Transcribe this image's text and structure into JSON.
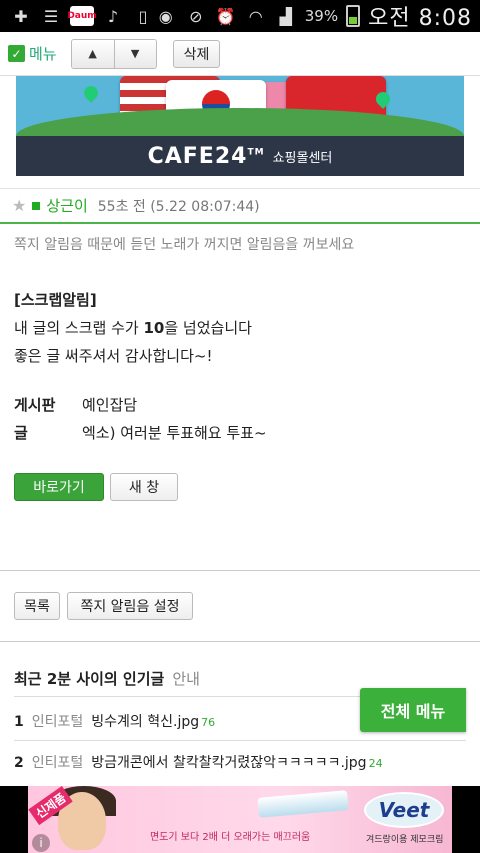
{
  "status_bar": {
    "battery_pct": "39%",
    "time": "오전 8:08",
    "icons": [
      "add-icon",
      "list-icon",
      "daum-app-icon",
      "music-icon",
      "download-done-icon",
      "eye-icon",
      "mute-icon",
      "alarm-icon",
      "wifi-icon",
      "signal-icon",
      "battery-icon"
    ],
    "daum_label": "Daum"
  },
  "toolbar": {
    "menu_label": "메뉴",
    "up_label": "▲",
    "down_label": "▼",
    "delete_label": "삭제"
  },
  "banner": {
    "logo": "CAFE24",
    "tm": "TM",
    "sub": "쇼핑몰센터"
  },
  "message": {
    "sender": "상근이",
    "meta": "55초 전 (5.22 08:07:44)",
    "notice": "쪽지 알림음 때문에 듣던 노래가 꺼지면 알림음을 꺼보세요",
    "heading": "[스크랩알림]",
    "line1_pre": "내 글의 스크랩 수가 ",
    "line1_bold": "10",
    "line1_post": "을 넘었습니다",
    "line2": "좋은 글 써주셔서 감사합니다~!",
    "board_key": "게시판",
    "board_val": "예인잡담",
    "post_key": "글",
    "post_val": "엑소) 여러분 투표해요 투표~",
    "go_label": "바로가기",
    "new_window_label": "새 창"
  },
  "actions": {
    "list_label": "목록",
    "settings_label": "쪽지 알림음 설정"
  },
  "popular": {
    "title": "최근 2분 사이의 인기글",
    "subtitle": "안내",
    "items": [
      {
        "rank": "1",
        "category": "인티포털",
        "title": "빙수계의 혁신.jpg",
        "count": "76"
      },
      {
        "rank": "2",
        "category": "인티포털",
        "title": "방금개콘에서 찰칵찰칵거렸잖악ㅋㅋㅋㅋㅋ.jpg",
        "count": "24"
      }
    ]
  },
  "full_menu_label": "전체 메뉴",
  "ad": {
    "badge": "신제품",
    "text": "면도기 보다 2배 더 오래가는 매끄러움",
    "text2": "겨드랑이용 제모크림",
    "brand": "Veet",
    "info": "i"
  }
}
